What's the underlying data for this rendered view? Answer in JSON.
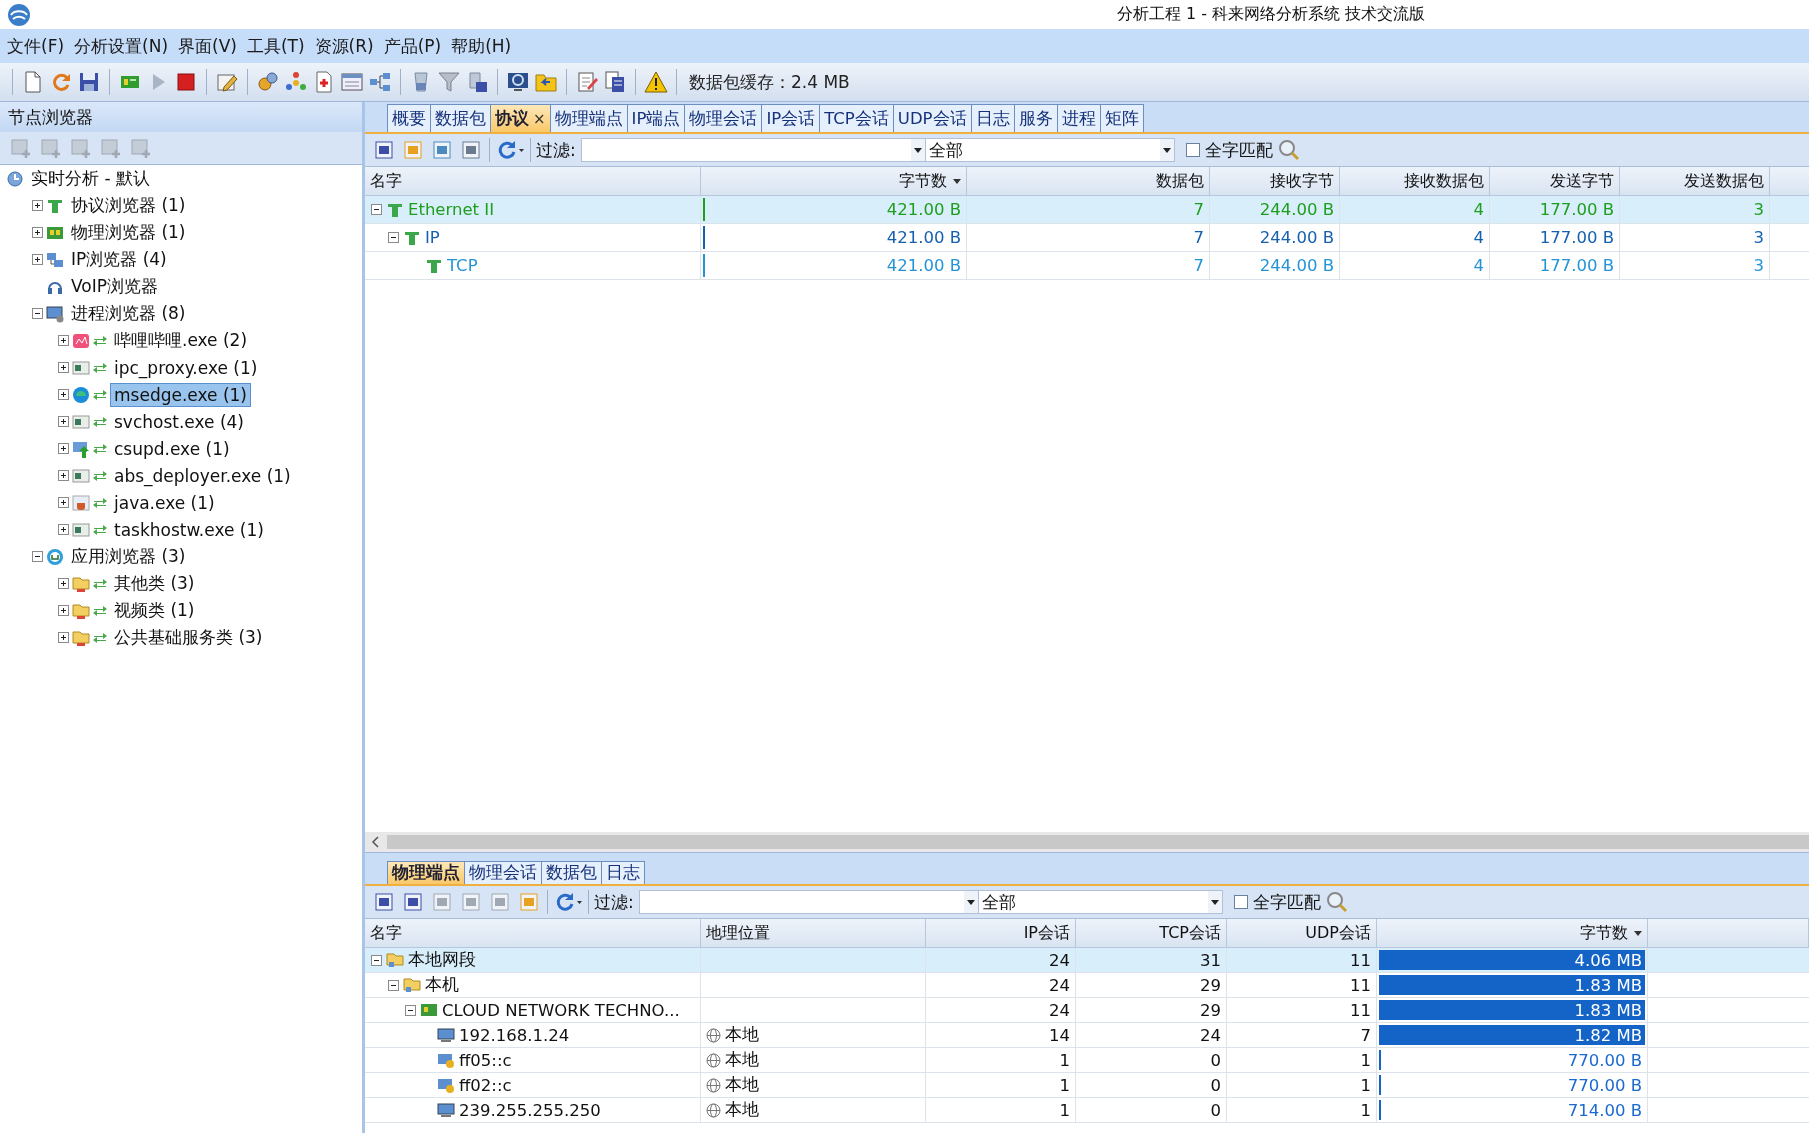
{
  "window": {
    "title": "分析工程 1 - 科来网络分析系统 技术交流版"
  },
  "menu": [
    "文件(F)",
    "分析设置(N)",
    "界面(V)",
    "工具(T)",
    "资源(R)",
    "产品(P)",
    "帮助(H)"
  ],
  "toolbar": {
    "buffer": "数据包缓存：2.4 MB"
  },
  "node_browser": {
    "title": "节点浏览器",
    "tree": [
      {
        "label": "实时分析 - 默认",
        "kind": "live",
        "selected": false,
        "children": [
          {
            "label": "协议浏览器 (1)",
            "kind": "protocol",
            "expanded": false,
            "selected": false
          },
          {
            "label": "物理浏览器 (1)",
            "kind": "physical",
            "expanded": false,
            "selected": false
          },
          {
            "label": "IP浏览器 (4)",
            "kind": "ip",
            "expanded": false,
            "selected": false
          },
          {
            "label": "VoIP浏览器",
            "kind": "voip",
            "selected": false
          },
          {
            "label": "进程浏览器 (8)",
            "kind": "process",
            "expanded": true,
            "selected": false,
            "children": [
              {
                "label": "哔哩哔哩.exe (2)",
                "kind": "pinkapp",
                "expanded": false,
                "selected": false
              },
              {
                "label": "ipc_proxy.exe (1)",
                "kind": "exe",
                "expanded": false,
                "selected": false
              },
              {
                "label": "msedge.exe (1)",
                "kind": "browser",
                "expanded": false,
                "selected": true
              },
              {
                "label": "svchost.exe (4)",
                "kind": "exe",
                "expanded": false,
                "selected": false
              },
              {
                "label": "csupd.exe (1)",
                "kind": "upload",
                "expanded": false,
                "selected": false
              },
              {
                "label": "abs_deployer.exe (1)",
                "kind": "exe",
                "expanded": false,
                "selected": false
              },
              {
                "label": "java.exe (1)",
                "kind": "cup",
                "expanded": false,
                "selected": false
              },
              {
                "label": "taskhostw.exe (1)",
                "kind": "exe",
                "expanded": false,
                "selected": false
              }
            ]
          },
          {
            "label": "应用浏览器 (3)",
            "kind": "app",
            "expanded": true,
            "selected": false,
            "children": [
              {
                "label": "其他类 (3)",
                "kind": "folder",
                "expanded": false,
                "selected": false
              },
              {
                "label": "视频类 (1)",
                "kind": "folder",
                "expanded": false,
                "selected": false
              },
              {
                "label": "公共基础服务类 (3)",
                "kind": "folder",
                "expanded": false,
                "selected": false
              }
            ]
          }
        ]
      }
    ]
  },
  "main": {
    "tabs": [
      {
        "label": "概要",
        "selected": false
      },
      {
        "label": "数据包",
        "selected": false
      },
      {
        "label": "协议",
        "selected": true,
        "close": "×"
      },
      {
        "label": "物理端点",
        "selected": false
      },
      {
        "label": "IP端点",
        "selected": false
      },
      {
        "label": "物理会话",
        "selected": false
      },
      {
        "label": "IP会话",
        "selected": false
      },
      {
        "label": "TCP会话",
        "selected": false
      },
      {
        "label": "UDP会话",
        "selected": false
      },
      {
        "label": "日志",
        "selected": false
      },
      {
        "label": "服务",
        "selected": false
      },
      {
        "label": "进程",
        "selected": false
      },
      {
        "label": "矩阵",
        "selected": false
      }
    ],
    "filter": {
      "label": "过滤:",
      "scope": "全部",
      "whole_word": {
        "label": "全字匹配",
        "checked": false
      }
    },
    "table": {
      "columns": [
        {
          "label": "名字",
          "sorted": false
        },
        {
          "label": "字节数",
          "sorted": true
        },
        {
          "label": "数据包",
          "sorted": false
        },
        {
          "label": "接收字节",
          "sorted": false
        },
        {
          "label": "接收数据包",
          "sorted": false
        },
        {
          "label": "发送字节",
          "sorted": false
        },
        {
          "label": "发送数据包",
          "sorted": false
        }
      ],
      "rows": [
        {
          "expanded": true,
          "selected": true,
          "color": "#1e9e1e",
          "level": 0.01,
          "cells": [
            "Ethernet II",
            "421.00 B",
            "7",
            "244.00 B",
            "4",
            "177.00 B",
            "3"
          ],
          "children": [
            {
              "expanded": true,
              "selected": false,
              "color": "#1560b0",
              "level": 0.01,
              "cells": [
                "IP",
                "421.00 B",
                "7",
                "244.00 B",
                "4",
                "177.00 B",
                "3"
              ],
              "children": [
                {
                  "selected": false,
                  "color": "#2394d6",
                  "level": 0.01,
                  "cells": [
                    "TCP",
                    "421.00 B",
                    "7",
                    "244.00 B",
                    "4",
                    "177.00 B",
                    "3"
                  ]
                }
              ]
            }
          ]
        }
      ]
    }
  },
  "detail": {
    "tabs": [
      {
        "label": "物理端点",
        "selected": true
      },
      {
        "label": "物理会话",
        "selected": false
      },
      {
        "label": "数据包",
        "selected": false
      },
      {
        "label": "日志",
        "selected": false
      }
    ],
    "filter": {
      "label": "过滤:",
      "scope": "全部",
      "whole_word": {
        "label": "全字匹配",
        "checked": false
      }
    },
    "table": {
      "columns": [
        {
          "label": "名字",
          "sorted": false
        },
        {
          "label": "地理位置",
          "sorted": false
        },
        {
          "label": "IP会话",
          "sorted": false
        },
        {
          "label": "TCP会话",
          "sorted": false
        },
        {
          "label": "UDP会话",
          "sorted": false
        },
        {
          "label": "字节数",
          "sorted": true
        }
      ],
      "rows": [
        {
          "kind": "segment",
          "expanded": true,
          "selected": true,
          "level": 1,
          "cells": [
            "本地网段",
            "",
            "24",
            "31",
            "11",
            "4.06 MB"
          ],
          "children": [
            {
              "kind": "segment",
              "expanded": true,
              "selected": false,
              "level": 1,
              "cells": [
                "本机",
                "",
                "24",
                "29",
                "11",
                "1.83 MB"
              ],
              "children": [
                {
                  "kind": "adapter",
                  "expanded": true,
                  "selected": false,
                  "level": 1,
                  "cells": [
                    "CLOUD NETWORK TECHNO...",
                    "",
                    "24",
                    "29",
                    "11",
                    "1.83 MB"
                  ],
                  "children": [
                    {
                      "kind": "host",
                      "selected": false,
                      "level": 1,
                      "cells": [
                        "192.168.1.24",
                        "本地",
                        "14",
                        "24",
                        "7",
                        "1.82 MB"
                      ]
                    },
                    {
                      "kind": "multicast",
                      "selected": false,
                      "level": 0.01,
                      "cells": [
                        "ff05::c",
                        "本地",
                        "1",
                        "0",
                        "1",
                        "770.00 B"
                      ]
                    },
                    {
                      "kind": "multicast",
                      "selected": false,
                      "level": 0.01,
                      "cells": [
                        "ff02::c",
                        "本地",
                        "1",
                        "0",
                        "1",
                        "770.00 B"
                      ]
                    },
                    {
                      "kind": "host",
                      "selected": false,
                      "level": 0.01,
                      "cells": [
                        "239.255.255.250",
                        "本地",
                        "1",
                        "0",
                        "1",
                        "714.00 B"
                      ]
                    }
                  ]
                }
              ]
            }
          ]
        }
      ]
    }
  }
}
